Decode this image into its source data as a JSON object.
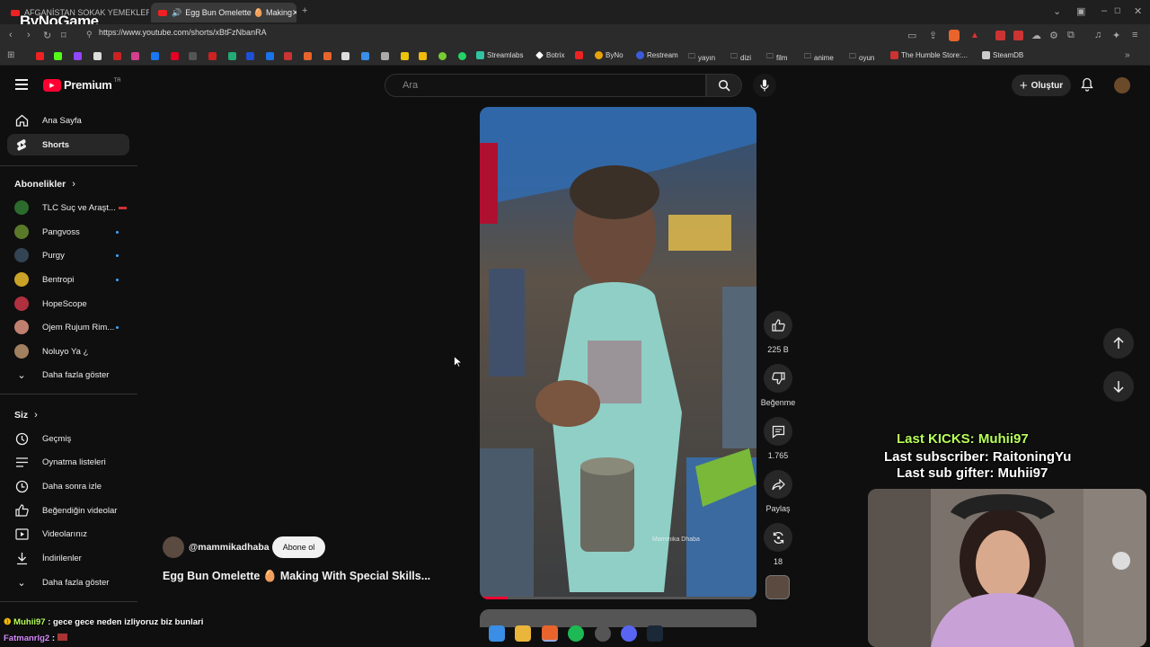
{
  "browser": {
    "tabs": [
      {
        "label": "AFGANİSTAN SOKAK YEMEKLERİNE"
      },
      {
        "label": "Egg Bun Omelette 🥚 Making"
      }
    ],
    "url": "https://www.youtube.com/shorts/xBtFzNbanRA",
    "bookmarks": [
      "Streamlabs",
      "Botrix",
      "ByNo",
      "Restream",
      "yayın",
      "dizi",
      "film",
      "anime",
      "oyun",
      "The Humble Store:...",
      "SteamDB"
    ]
  },
  "logo_overlay": "ByNoGame",
  "youtube": {
    "logo": "Premium",
    "logo_sup": "TR",
    "search_placeholder": "Ara",
    "create_label": "Oluştur"
  },
  "sidebar": {
    "main": [
      {
        "label": "Ana Sayfa",
        "icon": "home-icon"
      },
      {
        "label": "Shorts",
        "icon": "shorts-icon"
      }
    ],
    "subs_title": "Abonelikler",
    "subs": [
      {
        "label": "TLC Suç ve Araşt...",
        "color": "#2d6a2d"
      },
      {
        "label": "Pangvoss",
        "color": "#5a7a2a"
      },
      {
        "label": "Purgy",
        "color": "#345"
      },
      {
        "label": "Bentropi",
        "color": "#c9a227"
      },
      {
        "label": "HopeScope",
        "color": "#b03040"
      },
      {
        "label": "Ojem Rujum Rim...",
        "color": "#c08070"
      },
      {
        "label": "Noluyo Ya ¿",
        "color": "#a08060"
      }
    ],
    "show_more": "Daha fazla göster",
    "you_title": "Siz",
    "you": [
      {
        "label": "Geçmiş",
        "icon": "history-icon"
      },
      {
        "label": "Oynatma listeleri",
        "icon": "playlist-icon"
      },
      {
        "label": "Daha sonra izle",
        "icon": "clock-icon"
      },
      {
        "label": "Beğendiğin videolar",
        "icon": "like-icon"
      },
      {
        "label": "Videolarınız",
        "icon": "video-icon"
      },
      {
        "label": "İndirilenler",
        "icon": "download-icon"
      }
    ],
    "show_more2": "Daha fazla göster"
  },
  "short": {
    "channel": "@mammikadhaba",
    "subscribe": "Abone ol",
    "title": "Egg Bun Omelette 🥚 Making With Special Skills...",
    "watermark": "Mammika Dhaba",
    "likes": "225 B",
    "dislike_label": "Beğenme",
    "comments": "1.765",
    "share_label": "Paylaş",
    "remix_count": "18"
  },
  "stream_overlay": {
    "line1": "Last KICKS: Muhii97",
    "line2": "Last subscriber: RaitoningYu",
    "line3": "Last sub gifter: Muhii97"
  },
  "chat": [
    {
      "user": "Muhii97",
      "text": ": gece gece neden izliyoruz biz bunlari"
    },
    {
      "user": "Fatmanrlg2",
      "text": ":"
    }
  ]
}
